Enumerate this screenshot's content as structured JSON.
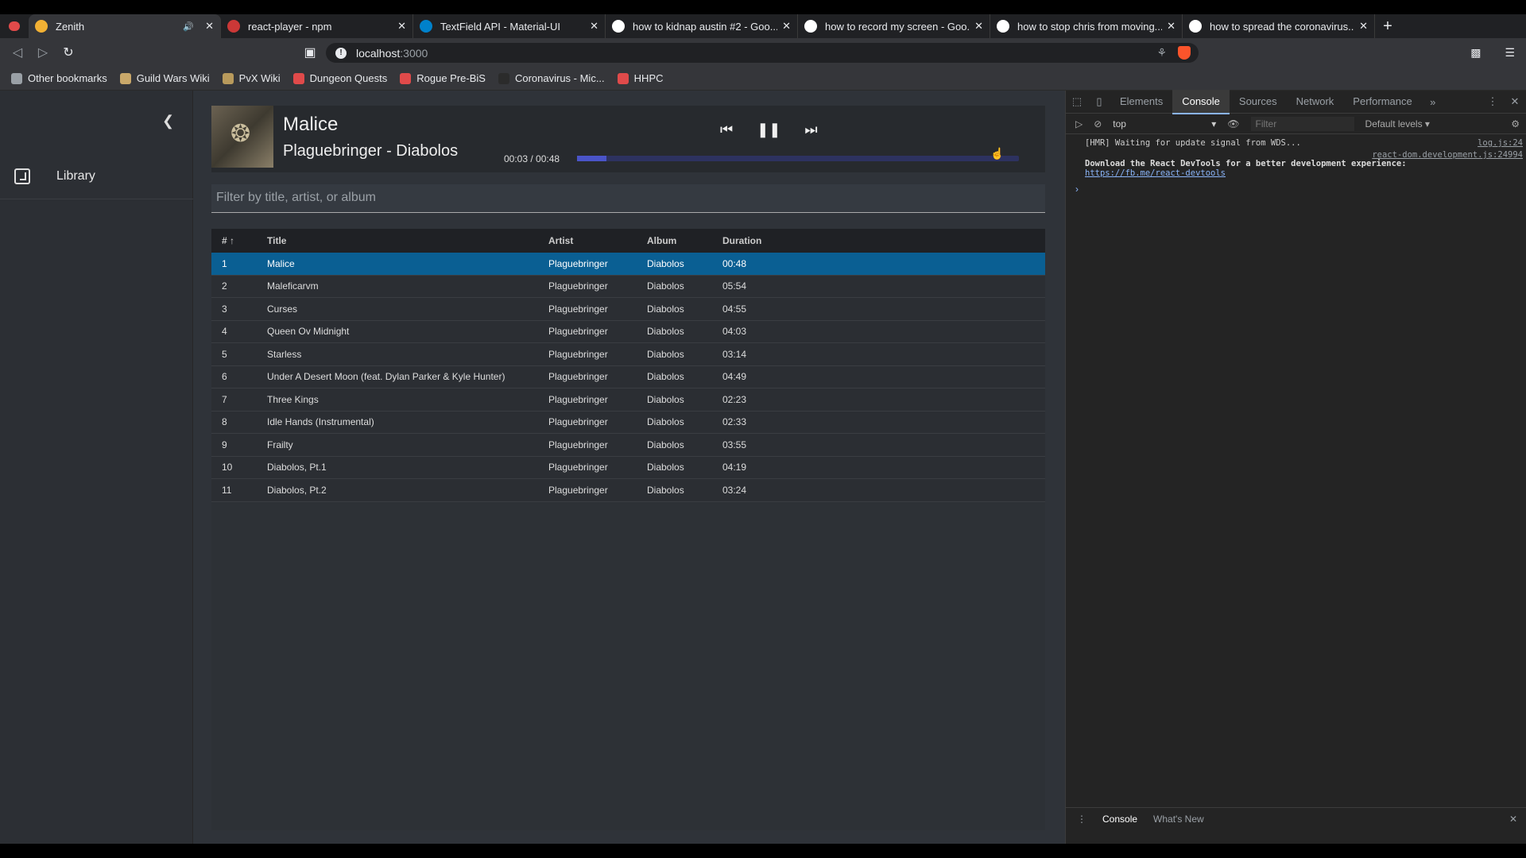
{
  "tabs": [
    {
      "title": "Zenith",
      "active": true,
      "audio": true,
      "fav_color": "#f2b134"
    },
    {
      "title": "react-player - npm",
      "fav_color": "#cb3837"
    },
    {
      "title": "TextField API - Material-UI",
      "fav_color": "#0081cb"
    },
    {
      "title": "how to kidnap austin #2 - Goo...",
      "fav_color": "#ffffff"
    },
    {
      "title": "how to record my screen - Goo...",
      "fav_color": "#ffffff"
    },
    {
      "title": "how to stop chris from moving...",
      "fav_color": "#ffffff"
    },
    {
      "title": "how to spread the coronavirus...",
      "fav_color": "#ffffff"
    }
  ],
  "url": {
    "host": "localhost",
    "port": ":3000"
  },
  "bookmarks": [
    {
      "label": "Other bookmarks",
      "color": "#9aa0a6"
    },
    {
      "label": "Guild Wars Wiki",
      "color": "#c9a86a"
    },
    {
      "label": "PvX Wiki",
      "color": "#b89a5c"
    },
    {
      "label": "Dungeon Quests",
      "color": "#e04a4a"
    },
    {
      "label": "Rogue Pre-BiS",
      "color": "#e04a4a"
    },
    {
      "label": "Coronavirus - Mic...",
      "color": "#2b2b2b"
    },
    {
      "label": "HHPC",
      "color": "#e04a4a"
    }
  ],
  "sidebar": {
    "library_label": "Library"
  },
  "player": {
    "song": "Malice",
    "artist_album": "Plaguebringer - Diabolos",
    "elapsed": "00:03",
    "separator": " / ",
    "total": "00:48",
    "progress_fraction": 0.066
  },
  "filter_placeholder": "Filter by title, artist, or album",
  "table": {
    "headers": {
      "num": "#",
      "sort": "↑",
      "title": "Title",
      "artist": "Artist",
      "album": "Album",
      "duration": "Duration"
    },
    "rows": [
      {
        "num": "1",
        "title": "Malice",
        "artist": "Plaguebringer",
        "album": "Diabolos",
        "duration": "00:48",
        "selected": true
      },
      {
        "num": "2",
        "title": "Maleficarvm",
        "artist": "Plaguebringer",
        "album": "Diabolos",
        "duration": "05:54"
      },
      {
        "num": "3",
        "title": "Curses",
        "artist": "Plaguebringer",
        "album": "Diabolos",
        "duration": "04:55"
      },
      {
        "num": "4",
        "title": "Queen Ov Midnight",
        "artist": "Plaguebringer",
        "album": "Diabolos",
        "duration": "04:03"
      },
      {
        "num": "5",
        "title": "Starless",
        "artist": "Plaguebringer",
        "album": "Diabolos",
        "duration": "03:14"
      },
      {
        "num": "6",
        "title": "Under A Desert Moon (feat. Dylan Parker & Kyle Hunter)",
        "artist": "Plaguebringer",
        "album": "Diabolos",
        "duration": "04:49"
      },
      {
        "num": "7",
        "title": "Three Kings",
        "artist": "Plaguebringer",
        "album": "Diabolos",
        "duration": "02:23"
      },
      {
        "num": "8",
        "title": "Idle Hands (Instrumental)",
        "artist": "Plaguebringer",
        "album": "Diabolos",
        "duration": "02:33"
      },
      {
        "num": "9",
        "title": "Frailty",
        "artist": "Plaguebringer",
        "album": "Diabolos",
        "duration": "03:55"
      },
      {
        "num": "10",
        "title": "Diabolos, Pt.1",
        "artist": "Plaguebringer",
        "album": "Diabolos",
        "duration": "04:19"
      },
      {
        "num": "11",
        "title": "Diabolos, Pt.2",
        "artist": "Plaguebringer",
        "album": "Diabolos",
        "duration": "03:24"
      }
    ]
  },
  "devtools": {
    "tabs": [
      "Elements",
      "Console",
      "Sources",
      "Network",
      "Performance"
    ],
    "active_tab": "Console",
    "context": "top",
    "filter_placeholder": "Filter",
    "levels": "Default levels ▾",
    "messages": [
      {
        "text": "[HMR] Waiting for update signal from WDS...",
        "source": "log.js:24"
      },
      {
        "text": "Download the React DevTools for a better development experience: ",
        "link": "https://fb.me/react-devtools",
        "source": "react-dom.development.js:24994"
      }
    ],
    "drawer_tabs": [
      "Console",
      "What's New"
    ]
  },
  "colors": {
    "selected_row": "#0a5f93",
    "progress": "#4a54c8"
  }
}
